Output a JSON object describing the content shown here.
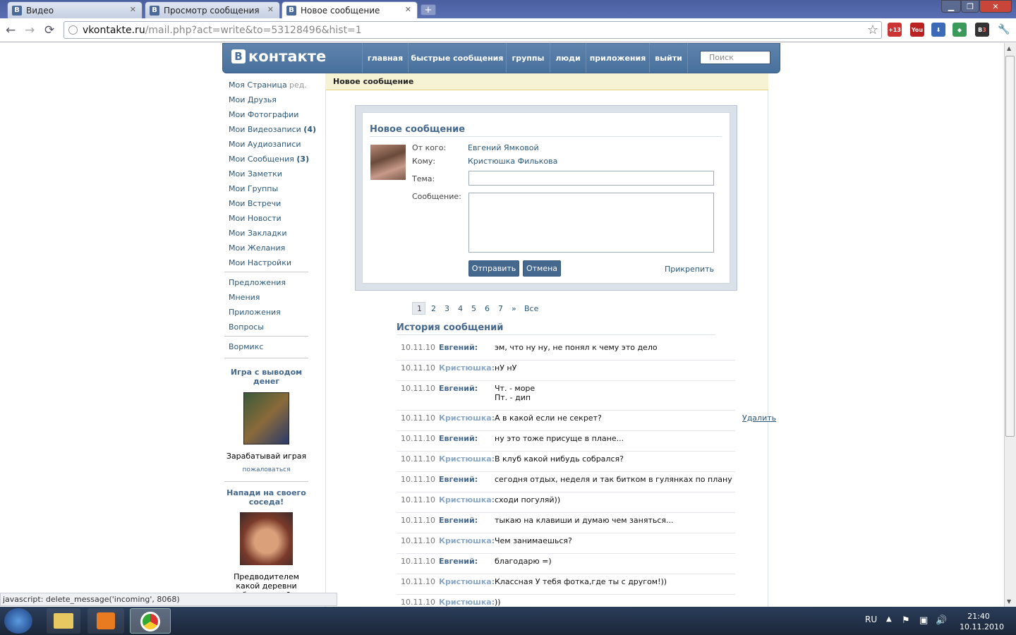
{
  "browser": {
    "tabs": [
      {
        "label": "Видео"
      },
      {
        "label": "Просмотр сообщения"
      },
      {
        "label": "Новое сообщение"
      }
    ],
    "url_domain": "vkontakte.ru",
    "url_path": "/mail.php?act=write&to=53128496&hist=1",
    "ext_badges": [
      "+13",
      "3"
    ],
    "status_text": "javascript: delete_message('incoming', 8068)"
  },
  "vk": {
    "logo_text": "контакте",
    "logo_letter": "В",
    "nav": [
      "главная",
      "быстрые сообщения",
      "группы",
      "люди",
      "приложения",
      "выйти"
    ],
    "search_placeholder": "Поиск"
  },
  "sidebar": {
    "items": [
      "Моя Страница",
      "Мои Друзья",
      "Мои Фотографии",
      "Мои Видеозаписи",
      "Мои Аудиозаписи",
      "Мои Сообщения",
      "Мои Заметки",
      "Мои Группы",
      "Мои Встречи",
      "Мои Новости",
      "Мои Закладки",
      "Мои Желания",
      "Мои Настройки"
    ],
    "edit": "ред.",
    "video_count": "(4)",
    "msg_count": "(3)",
    "items2": [
      "Предложения",
      "Мнения",
      "Приложения",
      "Вопросы"
    ],
    "items3": [
      "Вормикс"
    ],
    "ad1_title": "Игра с выводом денег",
    "ad1_text": "Зарабатывай играя",
    "complain": "пожаловаться",
    "ad2_title": "Напади на своего соседа!",
    "ad2_text": "Предводителем какой деревни будешь ты?"
  },
  "page": {
    "title": "Новое сообщение"
  },
  "form": {
    "heading": "Новое сообщение",
    "from_label": "От кого:",
    "from_value": "Евгений Ямковой",
    "to_label": "Кому:",
    "to_value": "Кристюшка Филькова",
    "subject_label": "Тема:",
    "message_label": "Сообщение:",
    "subject_value": "",
    "message_value": "",
    "send": "Отправить",
    "cancel": "Отмена",
    "attach": "Прикрепить"
  },
  "pagination": [
    "1",
    "2",
    "3",
    "4",
    "5",
    "6",
    "7",
    "»",
    "Все"
  ],
  "history": {
    "heading": "История сообщений",
    "delete_label": "Удалить",
    "messages": [
      {
        "date": "10.11.10",
        "author": "Евгений:",
        "text": "эм, что ну ну, не понял к чему это дело"
      },
      {
        "date": "10.11.10",
        "author": "Кристюшка:",
        "text": "нУ нУ"
      },
      {
        "date": "10.11.10",
        "author": "Евгений:",
        "text": "Чт. - море",
        "text2": "Пт. - дип"
      },
      {
        "date": "10.11.10",
        "author": "Кристюшка:",
        "text": "А в какой если не секрет?"
      },
      {
        "date": "10.11.10",
        "author": "Евгений:",
        "text": "ну это тоже присуще в плане..."
      },
      {
        "date": "10.11.10",
        "author": "Кристюшка:",
        "text": "В клуб какой нибудь собрался?"
      },
      {
        "date": "10.11.10",
        "author": "Евгений:",
        "text": "сегодня отдых, неделя и так битком в гулянках по плану"
      },
      {
        "date": "10.11.10",
        "author": "Кристюшка:",
        "text": "сходи погуляй))"
      },
      {
        "date": "10.11.10",
        "author": "Евгений:",
        "text": "тыкаю на клавиши и думаю чем заняться..."
      },
      {
        "date": "10.11.10",
        "author": "Кристюшка:",
        "text": "Чем занимаешься?"
      },
      {
        "date": "10.11.10",
        "author": "Евгений:",
        "text": "благодарю =)"
      },
      {
        "date": "10.11.10",
        "author": "Кристюшка:",
        "text": "Классная У тебя фотка,где ты с другом!))"
      },
      {
        "date": "10.11.10",
        "author": "Кристюшка:",
        "text": "))"
      }
    ]
  },
  "taskbar": {
    "lang": "RU",
    "time": "21:40",
    "date": "10.11.2010"
  },
  "colors": {
    "vk_blue": "#45688e",
    "header_blue": "#5f84ad",
    "sender_self": "#45688e",
    "sender_other": "#8aa7c4"
  }
}
